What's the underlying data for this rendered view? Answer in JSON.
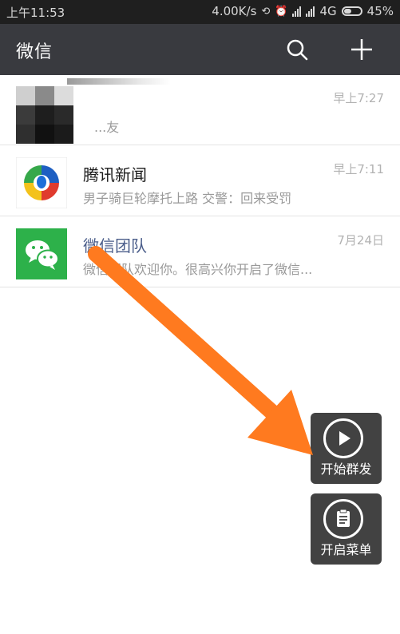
{
  "status_bar": {
    "time": "上午11:53",
    "net_speed": "4.00K/s",
    "network": "4G",
    "battery": "45%"
  },
  "header": {
    "title": "微信",
    "search_icon": "search-icon",
    "add_icon": "plus-icon",
    "colors": {
      "background": "#393a3f",
      "text": "#ffffff"
    }
  },
  "chats": [
    {
      "name": "",
      "preview": "...友",
      "time": "早上7:27",
      "avatar": "pixelated"
    },
    {
      "name": "腾讯新闻",
      "preview": "男子骑巨轮摩托上路 交警：回来受罚",
      "time": "早上7:11",
      "avatar": "tencent-news-logo"
    },
    {
      "name": "微信团队",
      "preview": "微信团队欢迎你。很高兴你开启了微信...",
      "time": "7月24日",
      "avatar": "wechat-logo"
    }
  ],
  "floating_buttons": [
    {
      "label": "开始群发",
      "icon": "play-icon"
    },
    {
      "label": "开启菜单",
      "icon": "clipboard-icon"
    }
  ],
  "annotation": {
    "type": "arrow",
    "color": "#ff7a1f"
  }
}
